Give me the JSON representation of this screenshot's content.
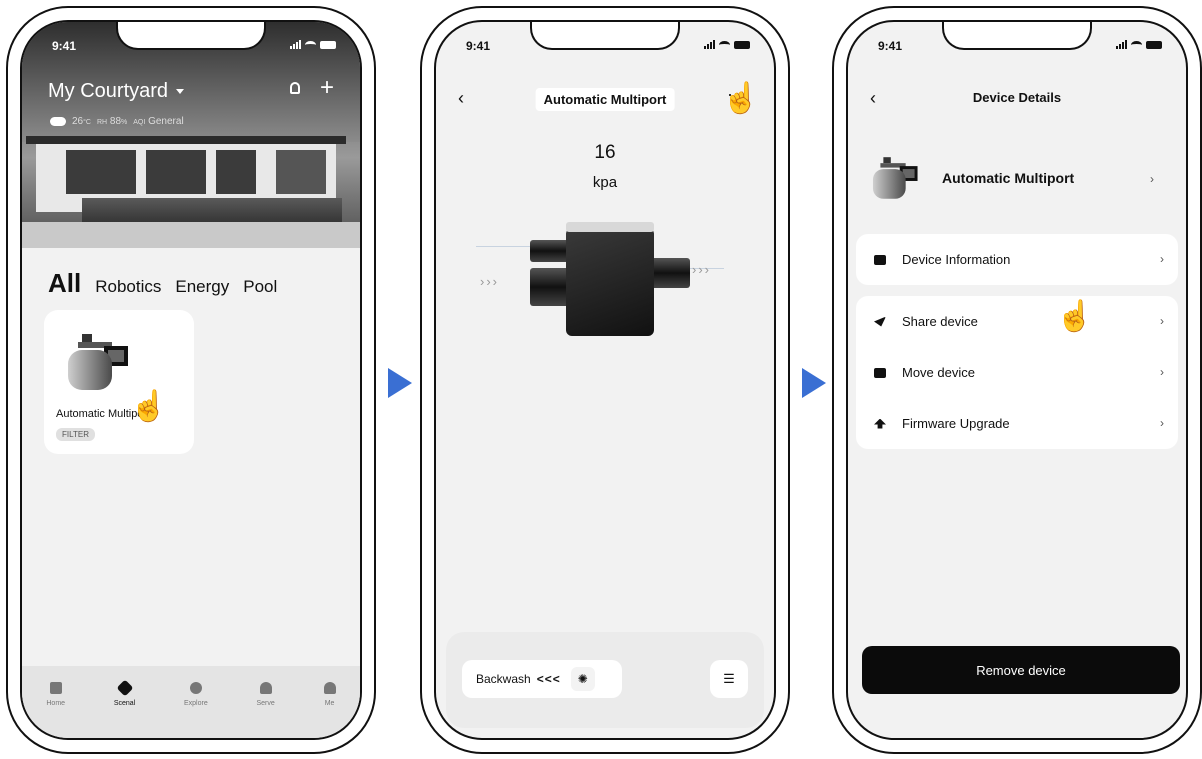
{
  "status": {
    "time": "9:41"
  },
  "screen1": {
    "home_name": "My Courtyard",
    "weather": {
      "temp": "26",
      "temp_unit": "°C",
      "humidity_label": "RH",
      "humidity": "88",
      "humidity_unit": "%",
      "aqi_label": "AQI",
      "aqi_value": "General"
    },
    "tabs": [
      "All",
      "Robotics",
      "Energy",
      "Pool"
    ],
    "device": {
      "name": "Automatic Multiport",
      "badge": "FILTER"
    },
    "nav": [
      "Home",
      "Scenal",
      "Explore",
      "Serve",
      "Me"
    ],
    "nav_active": "Scenal"
  },
  "screen2": {
    "title": "Automatic Multiport",
    "more_icon": "more-dots-icon",
    "pressure_value": "16",
    "pressure_unit": "kpa",
    "mode_label": "Backwash",
    "mode_arrows": "<<<"
  },
  "screen3": {
    "title": "Device Details",
    "device_name": "Automatic Multiport",
    "menu_group1": [
      "Device Information"
    ],
    "menu_group2": [
      "Share device",
      "Move device",
      "Firmware Upgrade"
    ],
    "remove_label": "Remove device"
  },
  "colors": {
    "arrow": "#3a6fd3",
    "dark": "#0b0b0b",
    "screen_bg": "#f2f2f2"
  }
}
